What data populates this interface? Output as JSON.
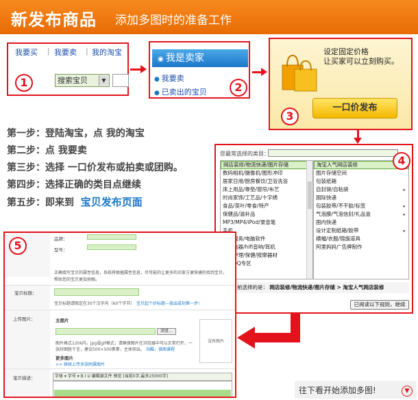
{
  "title": {
    "main": "新发布商品",
    "sub": "添加多图时的准备工作"
  },
  "box1": {
    "links": [
      "我要买",
      "我要卖",
      "我的淘宝"
    ],
    "search_select": "搜索宝贝"
  },
  "box2": {
    "header": "我是卖家",
    "links": [
      "我要卖",
      "已卖出的宝贝"
    ]
  },
  "box3": {
    "line1": "设定固定价格",
    "line2": "让买家可以立刻购买。",
    "button": "一口价发布"
  },
  "badges": [
    "1",
    "2",
    "3",
    "4",
    "5"
  ],
  "steps": [
    "第一步：登陆淘宝，点  我的淘宝",
    "第二步：点  我要卖",
    "第三步：选择  一口价发布或拍卖或团购。",
    "第四步：选择正确的类目点继续",
    "第五步：即来到"
  ],
  "step5_link": "宝贝发布页面",
  "box4": {
    "prompt": "您最常选择的类目：",
    "list1": [
      "网店装修/物流快递/图片存储",
      "数码相机/摄像机/图形冲印",
      "居家日用/厨房餐饮/卫浴洗浴",
      "床上用品/靠垫/窗帘/布艺",
      "时尚家饰/工艺品/十字绣",
      "食品/茶叶/零食/特产",
      "保健品/滋补品",
      "MP3/MP4/iPod/录音笔",
      "手机",
      "网络服务/电脑软件",
      "家用电器/hifi音响/耳机",
      "个人护理/保健/按摩器材",
      "腾讯QQ专区"
    ],
    "list2": [
      "淘宝人气网店装修",
      "图片存储空间",
      "包装纸箱",
      "自封袋/自粘袋",
      "国际快递",
      "包装胶带/不干胶/标签",
      "气泡膜/气泡信封/礼品盒",
      "国内快递",
      "设计定制纸箱/胶带",
      "横幅/衣服/锦旗道具",
      "阿里妈妈广告牌制作"
    ],
    "selected_label": "您当前选择的是：",
    "selected_path": "网店装修/物流快递/图片存储  >  淘宝人气网店装修",
    "continue_btn": "已阅读以下规则，继续"
  },
  "box5": {
    "brand_label": "品牌：",
    "model_label": "型号：",
    "help1": "正确填写宝贝的属性信息，系统将根据属性信息，尽可能的让更多的买家方便快捷的找到宝贝。",
    "help2": "帮助您的宝贝更加抢眼。",
    "title_label": "宝贝标题：",
    "title_hint": "宝贝标题请限定在30个汉字内（60个字节）",
    "title_link": "宝贝起个好标题—接出成功第一步!",
    "upload_label": "上传图片：",
    "main_image": "主图片",
    "browse": "浏览...",
    "upload_hint1": "图片格式120k内，jpg或gif格式；请确保图片在浏览器中可以正常打开，一",
    "upload_hint2": "张好图胜千言，建议500×500素素，主体突出。",
    "upload_links": "站酷，谁图课程",
    "more_images": "更多图片",
    "more_link": ">> 继续上传多张附属图片",
    "no_image": "没有图片",
    "desc_label": "宝贝描述：",
    "editor_toolbar": "字体 ▾  字号 ▾  B I U  编辑源文件  预览   [当前0字,最多25000字]"
  },
  "footer": {
    "more": "往下看开始添加多图!"
  },
  "colors": {
    "accent_red": "#e3121b",
    "title_orange": "#f08010",
    "link_blue": "#1c4fa8"
  }
}
